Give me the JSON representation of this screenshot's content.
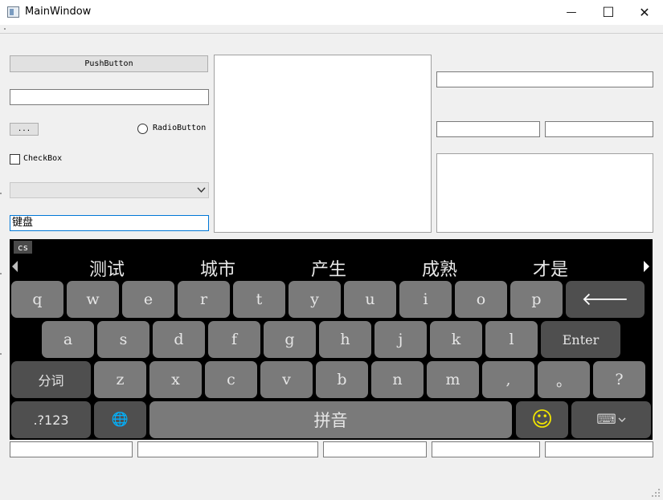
{
  "window": {
    "title": "MainWindow",
    "minimize_symbol": "—",
    "maximize_symbol": "☐",
    "close_symbol": "✕"
  },
  "left": {
    "push_button": "PushButton",
    "line_edit_value": "",
    "tool_button": "...",
    "radio_button": "RadioButton",
    "checkbox": "CheckBox",
    "combo_value": "",
    "input_text": "键盘"
  },
  "keyboard": {
    "language_badge": "cs",
    "candidates": [
      "测试",
      "城市",
      "产生",
      "成熟",
      "才是"
    ],
    "row1": [
      "q",
      "w",
      "e",
      "r",
      "t",
      "y",
      "u",
      "i",
      "o",
      "p"
    ],
    "row2": [
      "a",
      "s",
      "d",
      "f",
      "g",
      "h",
      "j",
      "k",
      "l"
    ],
    "row3": [
      "z",
      "x",
      "c",
      "v",
      "b",
      "n",
      "m",
      ",",
      "。",
      "?"
    ],
    "enter_label": "Enter",
    "segment_label": "分词",
    "symbols_label": ".?123",
    "space_label": "拼音",
    "backspace_symbol": "🡐",
    "globe_symbol": "🌐",
    "emoji_symbol": "☺",
    "hide_symbol": "⌨"
  },
  "colors": {
    "keyboard_bg": "#000000",
    "key": "#7a7a7a",
    "key_dark": "#4f4f4f",
    "emoji": "#f2e600"
  }
}
